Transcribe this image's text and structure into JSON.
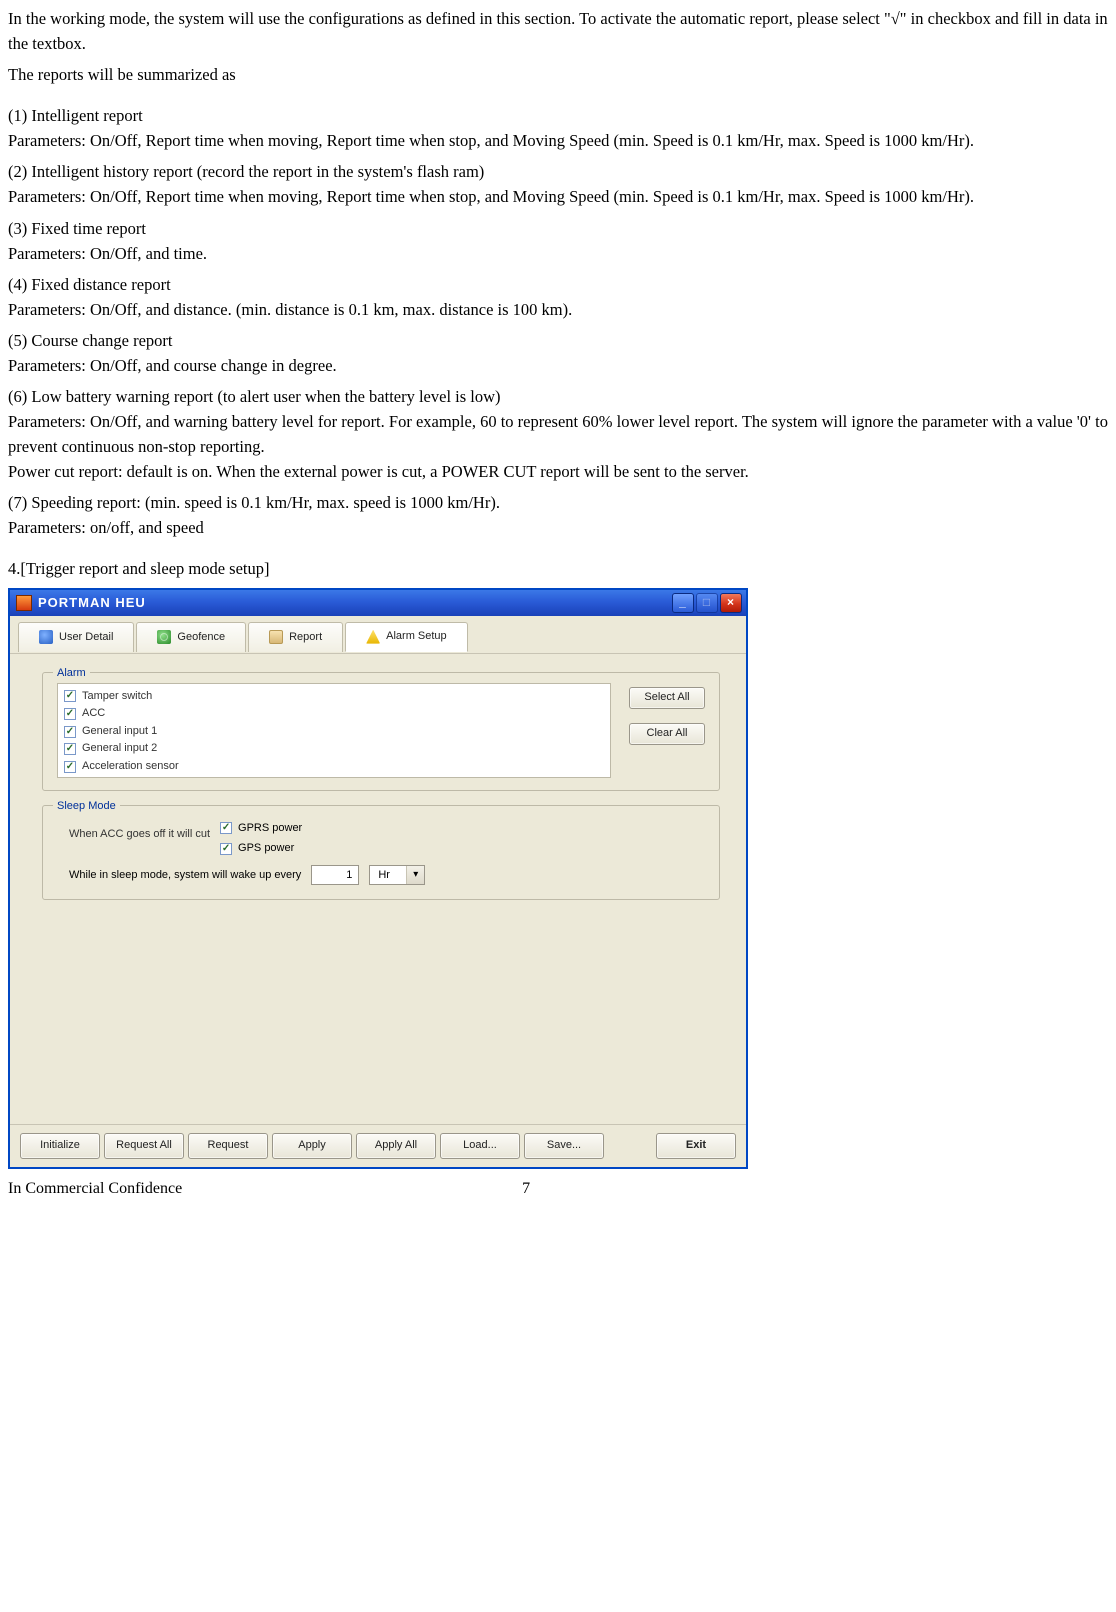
{
  "intro": {
    "p1": "In the working mode, the system will use the configurations as defined in this section. To activate the automatic report, please select \"√\" in checkbox and fill in data in the textbox.",
    "p2": "The reports will be summarized as"
  },
  "reports": {
    "r1_t": "(1) Intelligent report",
    "r1_d": "Parameters: On/Off, Report time when moving, Report time when stop, and Moving Speed (min. Speed is 0.1 km/Hr, max. Speed is 1000 km/Hr).",
    "r2_t": "(2) Intelligent history report (record the report in the system's flash ram)",
    "r2_d": "Parameters: On/Off, Report time when moving, Report time when stop, and Moving Speed (min. Speed is 0.1 km/Hr, max. Speed is 1000 km/Hr).",
    "r3_t": "(3) Fixed time report",
    "r3_d": "Parameters: On/Off, and time.",
    "r4_t": "(4) Fixed distance report",
    "r4_d": "Parameters: On/Off, and distance. (min. distance is 0.1 km, max. distance is 100 km).",
    "r5_t": "(5) Course change report",
    "r5_d": "Parameters: On/Off, and course change in degree.",
    "r6_t": "(6) Low battery warning report (to alert user when the battery level is low)",
    "r6_d1": "Parameters: On/Off, and warning battery level for report. For example, 60 to represent 60% lower level report. The system will ignore the parameter with a value '0' to prevent continuous non-stop reporting.",
    "r6_d2": "Power cut report: default is on. When the external power is cut, a POWER CUT report will be sent to the server.",
    "r7_t": "(7) Speeding report: (min. speed is 0.1 km/Hr, max. speed is 1000 km/Hr).",
    "r7_d": "Parameters: on/off, and speed"
  },
  "caption": "4.[Trigger report and sleep mode setup]",
  "window": {
    "title": "PORTMAN  HEU",
    "tabs": {
      "t1": "User Detail",
      "t2": "Geofence",
      "t3": "Report",
      "t4": "Alarm Setup"
    },
    "alarm": {
      "legend": "Alarm",
      "items": [
        "Tamper switch",
        "ACC",
        "General input 1",
        "General input 2",
        "Acceleration sensor"
      ],
      "select_all": "Select All",
      "clear_all": "Clear All"
    },
    "sleep": {
      "legend": "Sleep Mode",
      "row1_label": "When ACC goes off it will cut",
      "opt_gprs": "GPRS power",
      "opt_gps": "GPS power",
      "row2_label": "While in sleep mode, system will wake up every",
      "interval_value": "1",
      "interval_unit": "Hr"
    },
    "buttons": {
      "initialize": "Initialize",
      "request_all": "Request All",
      "request": "Request",
      "apply": "Apply",
      "apply_all": "Apply All",
      "load": "Load...",
      "save": "Save...",
      "exit": "Exit"
    }
  },
  "footer": {
    "left": "In Commercial Confidence",
    "page": "7"
  }
}
